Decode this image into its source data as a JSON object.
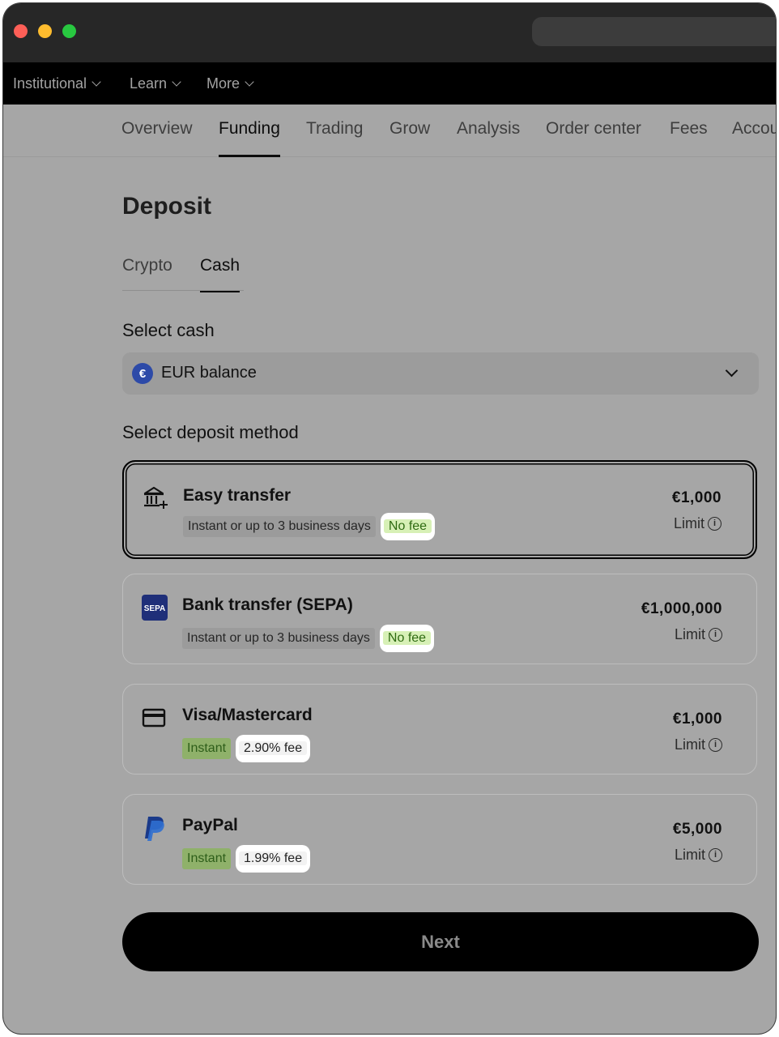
{
  "topnav": {
    "items": [
      {
        "label": "Institutional"
      },
      {
        "label": "Learn"
      },
      {
        "label": "More"
      }
    ]
  },
  "tabs": [
    {
      "label": "Overview"
    },
    {
      "label": "Funding"
    },
    {
      "label": "Trading"
    },
    {
      "label": "Grow"
    },
    {
      "label": "Analysis"
    },
    {
      "label": "Order center"
    },
    {
      "label": "Fees"
    },
    {
      "label": "Account"
    }
  ],
  "page": {
    "title": "Deposit",
    "subtabs": [
      "Crypto",
      "Cash"
    ],
    "select_cash_label": "Select cash",
    "select_value": "EUR balance",
    "currency_symbol": "€",
    "select_method_label": "Select deposit method",
    "next_label": "Next"
  },
  "methods": [
    {
      "title": "Easy transfer",
      "desc": "Instant or up to 3 business days",
      "fee": "No fee",
      "amount": "€1,000",
      "limit": "Limit"
    },
    {
      "title": "Bank transfer (SEPA)",
      "desc": "Instant or up to 3 business days",
      "fee": "No fee",
      "amount": "€1,000,000",
      "limit": "Limit"
    },
    {
      "title": "Visa/Mastercard",
      "desc": "Instant",
      "fee": "2.90% fee",
      "amount": "€1,000",
      "limit": "Limit"
    },
    {
      "title": "PayPal",
      "desc": "Instant",
      "fee": "1.99% fee",
      "amount": "€5,000",
      "limit": "Limit"
    }
  ],
  "icons": {
    "bank": "bank-icon",
    "sepa": "sepa-icon",
    "card": "credit-card-icon",
    "paypal": "paypal-icon",
    "sepa_text": "SEPA"
  },
  "colors": {
    "accent": "#000000",
    "fee_green": "#d7f0b6",
    "instant_green": "#8fb16a"
  }
}
